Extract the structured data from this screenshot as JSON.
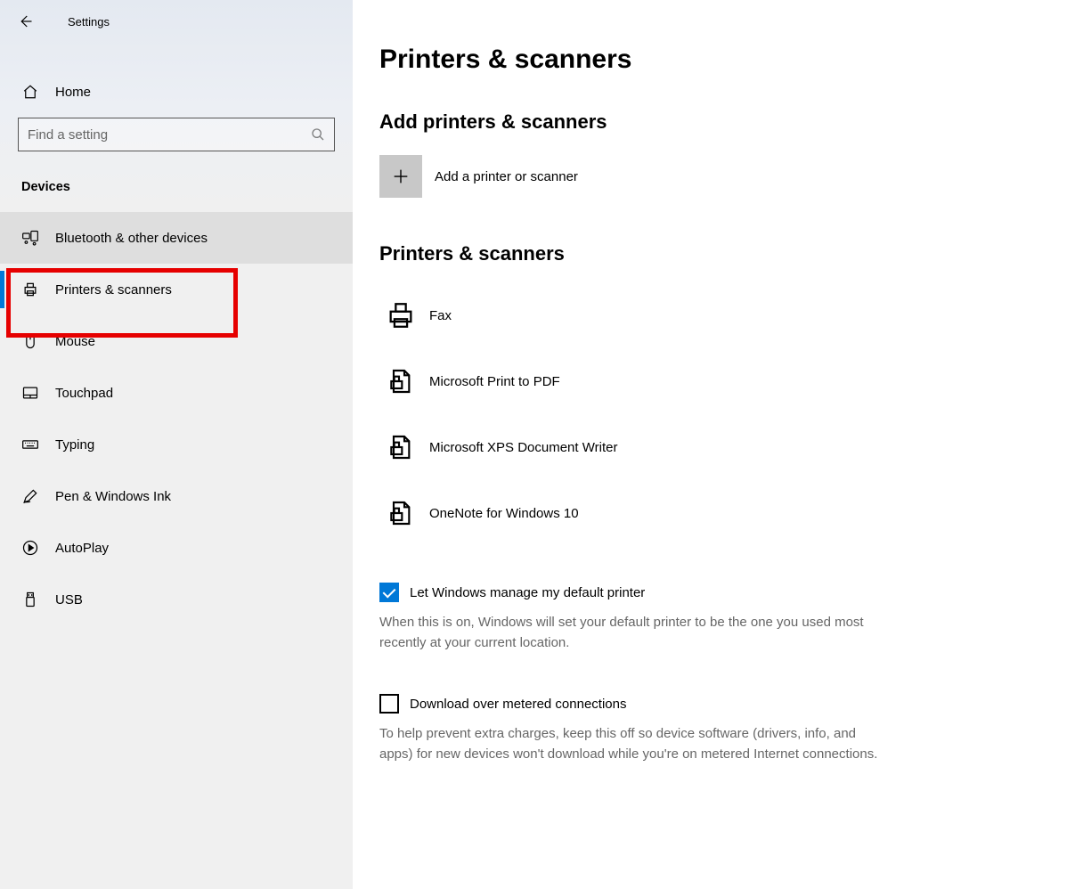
{
  "app_title": "Settings",
  "home_label": "Home",
  "search_placeholder": "Find a setting",
  "section_label": "Devices",
  "nav": [
    {
      "label": "Bluetooth & other devices"
    },
    {
      "label": "Printers & scanners"
    },
    {
      "label": "Mouse"
    },
    {
      "label": "Touchpad"
    },
    {
      "label": "Typing"
    },
    {
      "label": "Pen & Windows Ink"
    },
    {
      "label": "AutoPlay"
    },
    {
      "label": "USB"
    }
  ],
  "page_title": "Printers & scanners",
  "add_section_title": "Add printers & scanners",
  "add_label": "Add a printer or scanner",
  "list_section_title": "Printers & scanners",
  "printers": [
    {
      "label": "Fax"
    },
    {
      "label": "Microsoft Print to PDF"
    },
    {
      "label": "Microsoft XPS Document Writer"
    },
    {
      "label": "OneNote for Windows 10"
    }
  ],
  "default_printer": {
    "label": "Let Windows manage my default printer",
    "help": "When this is on, Windows will set your default printer to be the one you used most recently at your current location."
  },
  "metered": {
    "label": "Download over metered connections",
    "help": "To help prevent extra charges, keep this off so device software (drivers, info, and apps) for new devices won't download while you're on metered Internet connections."
  }
}
